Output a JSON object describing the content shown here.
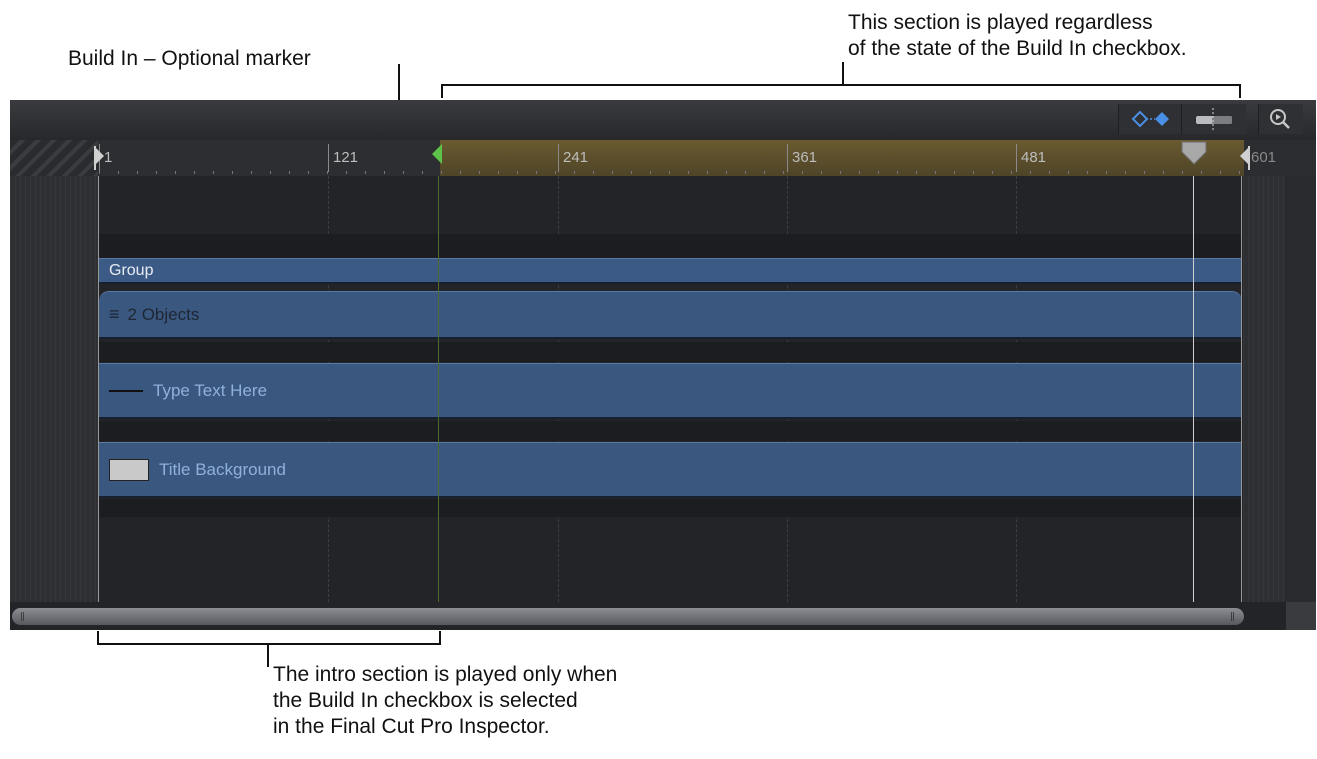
{
  "annotations": {
    "build_in_label": "Build In – Optional marker",
    "top_right_label": "This section is played regardless\nof the state of the Build In checkbox.",
    "bottom_label": "The intro section is played only when\nthe Build In checkbox is selected\nin the Final Cut Pro Inspector."
  },
  "toolbar": {
    "icons": [
      "keyframe-nav-icon",
      "snapping-icon",
      "zoom-icon"
    ],
    "accent_color": "#4a8fe6"
  },
  "ruler": {
    "ticks": [
      "1",
      "121",
      "241",
      "361",
      "481",
      "601"
    ],
    "outro_color": "#6a5a30",
    "marker_color": "#5cc24a"
  },
  "tracks": {
    "group": "Group",
    "objects": "2 Objects",
    "text_layer": "Type Text Here",
    "background_layer": "Title Background"
  }
}
